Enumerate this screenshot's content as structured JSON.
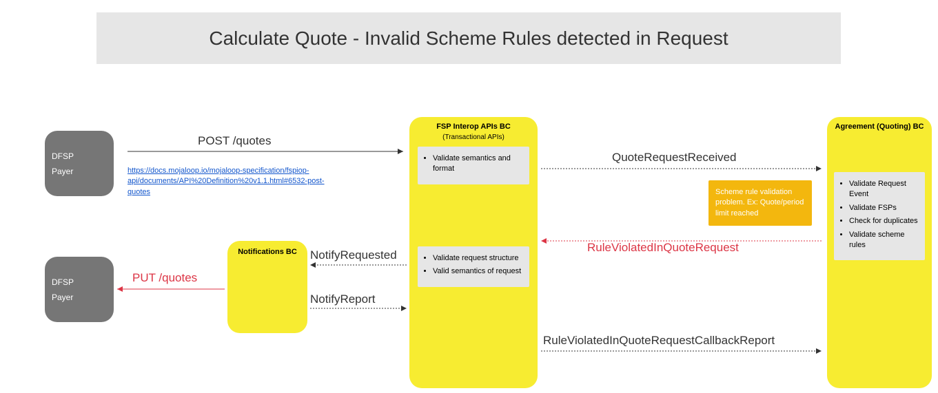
{
  "title": "Calculate Quote - Invalid Scheme Rules detected in Request",
  "nodes": {
    "dfsp_payer_1": {
      "line1": "DFSP",
      "line2": "Payer"
    },
    "dfsp_payer_2": {
      "line1": "DFSP",
      "line2": "Payer"
    },
    "notifications": {
      "title": "Notifications BC"
    },
    "fsp": {
      "title": "FSP Interop APIs BC",
      "subtitle": "(Transactional APIs)",
      "box1": {
        "item1": "Validate semantics and format"
      },
      "box2": {
        "item1": "Validate request structure",
        "item2": "Valid semantics of request"
      }
    },
    "agreement": {
      "title": "Agreement (Quoting) BC",
      "box1": {
        "item1": "Validate Request Event",
        "item2": "Validate FSPs",
        "item3": "Check for duplicates",
        "item4": "Validate scheme rules"
      }
    }
  },
  "warning": "Scheme rule validation problem. Ex: Quote/period limit reached",
  "labels": {
    "post_quotes": "POST /quotes",
    "put_quotes": "PUT /quotes",
    "quote_request_received": "QuoteRequestReceived",
    "rule_violated_request": "RuleViolatedInQuoteRequest",
    "notify_requested": "NotifyRequested",
    "notify_report": "NotifyReport",
    "callback_report": "RuleViolatedInQuoteRequestCallbackReport"
  },
  "link": {
    "text": "https://docs.mojaloop.io/mojaloop-specification/fspiop-api/documents/API%20Definition%20v1.1.html#6532-post-quotes",
    "href": "https://docs.mojaloop.io/mojaloop-specification/fspiop-api/documents/API%20Definition%20v1.1.html#6532-post-quotes"
  }
}
